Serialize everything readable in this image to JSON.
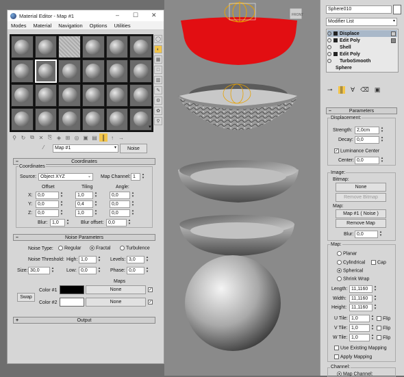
{
  "material_editor": {
    "title": "Material Editor - Map #1",
    "menu": [
      "Modes",
      "Material",
      "Navigation",
      "Options",
      "Utilities"
    ],
    "map_name": "Map #1",
    "map_type": "Noise",
    "coordinates": {
      "header": "Coordinates",
      "group_label": "Coordinates",
      "source_label": "Source:",
      "source_value": "Object XYZ",
      "map_channel_label": "Map Channel:",
      "map_channel_value": "1",
      "offset_label": "Offset",
      "tiling_label": "Tiling",
      "angle_label": "Angle:",
      "axes": [
        "X:",
        "Y:",
        "Z:"
      ],
      "offset": [
        "0,0",
        "0,0",
        "0,0"
      ],
      "tiling": [
        "1,0",
        "0,4",
        "1,0"
      ],
      "angle": [
        "0,0",
        "0,0",
        "0,0"
      ],
      "blur_label": "Blur:",
      "blur_value": "1,0",
      "blur_offset_label": "Blur offset:",
      "blur_offset_value": "0,0"
    },
    "noise": {
      "header": "Noise Parameters",
      "type_label": "Noise Type:",
      "types": [
        "Regular",
        "Fractal",
        "Turbulence"
      ],
      "selected_type": "Fractal",
      "threshold_label": "Noise Threshold:",
      "high_label": "High:",
      "high_value": "1,0",
      "levels_label": "Levels:",
      "levels_value": "3,0",
      "size_label": "Size:",
      "size_value": "30,0",
      "low_label": "Low:",
      "low_value": "0,0",
      "phase_label": "Phase:",
      "phase_value": "0,0",
      "maps_label": "Maps",
      "swap_label": "Swap",
      "color1_label": "Color #1",
      "color2_label": "Color #2",
      "color1": "#000000",
      "color2": "#ffffff",
      "map1": "None",
      "map2": "None"
    },
    "output_header": "Output"
  },
  "command_panel": {
    "object_name": "Sphere010",
    "object_color": "#ffffff",
    "modifier_list_label": "Modifier List",
    "stack": [
      {
        "label": "Displace",
        "selected": true
      },
      {
        "label": "Edit Poly",
        "selected": false
      },
      {
        "label": "Shell",
        "selected": false
      },
      {
        "label": "Edit Poly",
        "selected": false
      },
      {
        "label": "TurboSmooth",
        "selected": false
      },
      {
        "label": "Sphere",
        "selected": false
      }
    ],
    "parameters_header": "Parameters",
    "displacement_label": "Displacement:",
    "strength_label": "Strength:",
    "strength_value": "2,0cm",
    "decay_label": "Decay:",
    "decay_value": "0,0",
    "luminance_center_label": "Luminance Center",
    "center_label": "Center:",
    "center_value": "0,0",
    "image_label": "Image:",
    "bitmap_label": "Bitmap:",
    "bitmap_button": "None",
    "remove_bitmap": "Remove Bitmap",
    "map_label": "Map:",
    "map_button": "Map #1  ( Noise )",
    "remove_map": "Remove Map",
    "blur_label": "Blur:",
    "blur_value": "0,0",
    "map_section_label": "Map:",
    "map_types": [
      "Planar",
      "Cylindrical",
      "Spherical",
      "Shrink Wrap"
    ],
    "cap_label": "Cap",
    "selected_map_type": "Spherical",
    "length_label": "Length:",
    "length_value": "11,1160",
    "width_label": "Width:",
    "width_value": "11,1160",
    "height_label": "Height:",
    "height_value": "11,1160",
    "utile_label": "U Tile:",
    "vtile_label": "V Tile:",
    "wtile_label": "W Tile:",
    "tile_value": "1,0",
    "flip_label": "Flip",
    "use_existing_label": "Use Existing Mapping",
    "apply_mapping_label": "Apply Mapping",
    "channel_label": "Channel:",
    "map_channel_label": "Map Channel:"
  },
  "viewport": {
    "gizmo_label": "FRONT"
  }
}
